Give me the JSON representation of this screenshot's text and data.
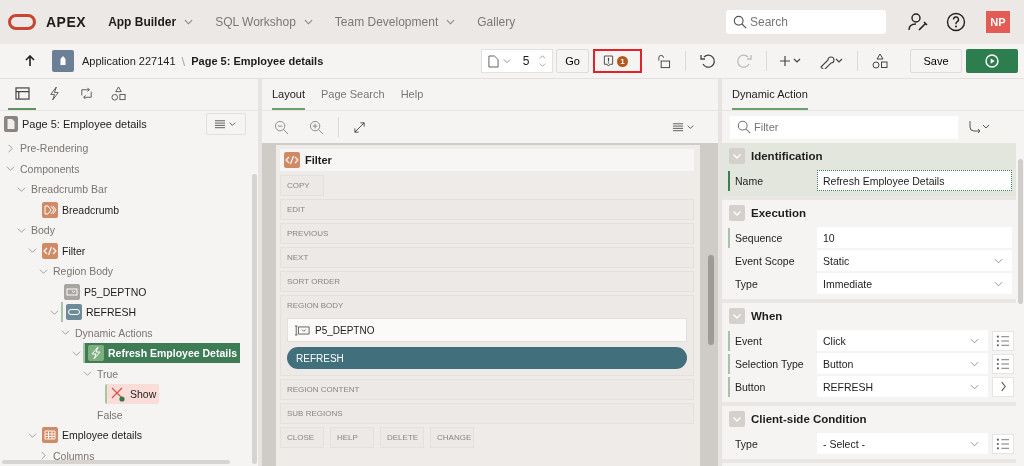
{
  "header": {
    "logo": "APEX",
    "nav": [
      {
        "label": "App Builder",
        "selected": true,
        "menu": true
      },
      {
        "label": "SQL Workshop",
        "selected": false,
        "menu": true
      },
      {
        "label": "Team Development",
        "selected": false,
        "menu": true
      },
      {
        "label": "Gallery",
        "selected": false,
        "menu": false
      }
    ],
    "search": {
      "placeholder": "Search"
    },
    "avatar": "NP"
  },
  "toolbar": {
    "application": "Application 227141",
    "separator": "\\",
    "page": "Page 5: Employee details",
    "page_number": "5",
    "go": "Go",
    "issues_count": "1",
    "undo": {
      "disabled": false
    },
    "redo": {
      "disabled": true
    },
    "save": "Save"
  },
  "left_panel": {
    "tabs": [
      {
        "kind": "rendering",
        "selected": true
      },
      {
        "kind": "dynamic_actions",
        "selected": false
      },
      {
        "kind": "processing",
        "selected": false
      },
      {
        "kind": "shared",
        "selected": false
      }
    ],
    "page_title": "Page 5: Employee details",
    "tree": [
      {
        "label": "Pre-Rendering",
        "kind": "group",
        "expanded": false,
        "selected": false,
        "marker": false
      },
      {
        "label": "Components",
        "kind": "group",
        "expanded": true,
        "selected": false,
        "marker": false,
        "children": [
          {
            "label": "Breadcrumb Bar",
            "kind": "group",
            "expanded": true,
            "selected": false,
            "marker": false,
            "children": [
              {
                "label": "Breadcrumb",
                "kind": "breadcrumb",
                "selected": false,
                "marker": false
              }
            ]
          },
          {
            "label": "Body",
            "kind": "group",
            "expanded": true,
            "selected": false,
            "marker": false,
            "children": [
              {
                "label": "Filter",
                "kind": "region",
                "expanded": true,
                "selected": false,
                "marker": false,
                "children": [
                  {
                    "label": "Region Body",
                    "kind": "group",
                    "expanded": true,
                    "selected": false,
                    "marker": false,
                    "children": [
                      {
                        "label": "P5_DEPTNO",
                        "kind": "item",
                        "selected": false,
                        "marker": false
                      },
                      {
                        "label": "REFRESH",
                        "kind": "button",
                        "expanded": true,
                        "selected": false,
                        "marker": true,
                        "children": [
                          {
                            "label": "Dynamic Actions",
                            "kind": "group",
                            "expanded": true,
                            "selected": false,
                            "marker": false,
                            "children": [
                              {
                                "label": "Refresh Employee Details",
                                "kind": "dynamic_action",
                                "expanded": true,
                                "selected": true,
                                "marker": true,
                                "children": [
                                  {
                                    "label": "True",
                                    "kind": "group",
                                    "expanded": true,
                                    "selected": false,
                                    "marker": false,
                                    "children": [
                                      {
                                        "label": "Show",
                                        "kind": "action",
                                        "selected": false,
                                        "marker": true
                                      }
                                    ]
                                  },
                                  {
                                    "label": "False",
                                    "kind": "group",
                                    "selected": false,
                                    "marker": false
                                  }
                                ]
                              }
                            ]
                          }
                        ]
                      }
                    ]
                  }
                ]
              },
              {
                "label": "Employee details",
                "kind": "report",
                "expanded": true,
                "selected": false,
                "marker": false,
                "children": [
                  {
                    "label": "Columns",
                    "kind": "group",
                    "expanded": false,
                    "selected": false,
                    "marker": false
                  }
                ]
              }
            ]
          }
        ]
      }
    ]
  },
  "layout_panel": {
    "tabs": [
      {
        "label": "Layout",
        "selected": true
      },
      {
        "label": "Page Search",
        "selected": false
      },
      {
        "label": "Help",
        "selected": false
      }
    ],
    "region": "Filter",
    "slot_rows": [
      {
        "kind": "short",
        "labels": [
          "COPY"
        ]
      },
      {
        "kind": "wide",
        "label": "EDIT"
      },
      {
        "kind": "wide",
        "label": "PREVIOUS"
      },
      {
        "kind": "wide",
        "label": "NEXT"
      },
      {
        "kind": "wide",
        "label": "SORT ORDER"
      },
      {
        "kind": "body",
        "label": "REGION BODY",
        "items": [
          {
            "kind": "item",
            "label": "P5_DEPTNO"
          },
          {
            "kind": "button",
            "label": "REFRESH"
          }
        ]
      },
      {
        "kind": "wide",
        "label": "REGION CONTENT"
      },
      {
        "kind": "wide",
        "label": "SUB REGIONS"
      },
      {
        "kind": "short",
        "labels": [
          "CLOSE",
          "HELP",
          "DELETE",
          "CHANGE"
        ]
      }
    ]
  },
  "property_panel": {
    "tabs": [
      {
        "label": "Dynamic Action",
        "selected": true
      }
    ],
    "filter": {
      "placeholder": "Filter"
    },
    "sections": [
      {
        "title": "Identification",
        "expanded": true,
        "highlighted": true,
        "properties": [
          {
            "label": "Name",
            "value": "Refresh Employee Details",
            "kind": "text",
            "required": true,
            "focused": true
          }
        ]
      },
      {
        "title": "Execution",
        "expanded": true,
        "highlighted": false,
        "properties": [
          {
            "label": "Sequence",
            "value": "10",
            "kind": "text",
            "required": true,
            "focused": false
          },
          {
            "label": "Event Scope",
            "value": "Static",
            "kind": "select",
            "required": false,
            "focused": false
          },
          {
            "label": "Type",
            "value": "Immediate",
            "kind": "select",
            "required": false,
            "focused": false
          }
        ]
      },
      {
        "title": "When",
        "expanded": true,
        "highlighted": false,
        "properties": [
          {
            "label": "Event",
            "value": "Click",
            "kind": "select",
            "required": true,
            "focused": false,
            "action": {
              "kind": "list"
            }
          },
          {
            "label": "Selection Type",
            "value": "Button",
            "kind": "select",
            "required": true,
            "focused": false,
            "action": {
              "kind": "list"
            }
          },
          {
            "label": "Button",
            "value": "REFRESH",
            "kind": "select",
            "required": true,
            "focused": false,
            "action": {
              "kind": "go"
            }
          }
        ]
      },
      {
        "title": "Client-side Condition",
        "expanded": true,
        "highlighted": false,
        "properties": [
          {
            "label": "Type",
            "value": "- Select -",
            "kind": "select",
            "required": false,
            "focused": false,
            "action": {
              "kind": "list"
            }
          }
        ]
      }
    ]
  }
}
